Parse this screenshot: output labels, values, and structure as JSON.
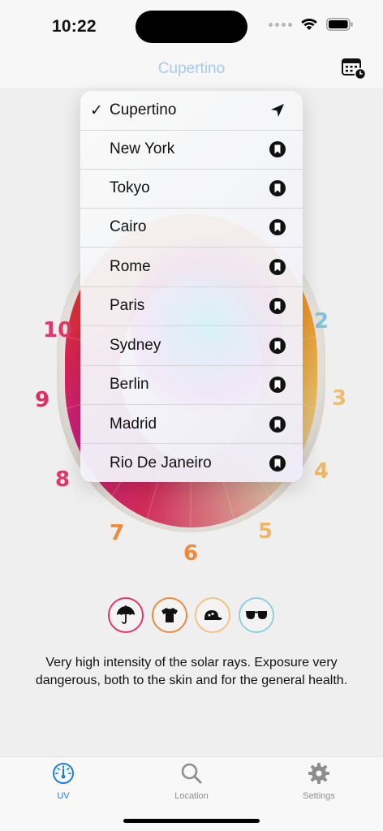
{
  "status_bar": {
    "time": "10:22"
  },
  "nav": {
    "title": "Cupertino",
    "calendar_icon": "calendar-clock-icon"
  },
  "uv_dial": {
    "hours": [
      "10",
      "9",
      "8",
      "7",
      "6",
      "5",
      "4",
      "3",
      "2"
    ],
    "colors": {
      "10": "#e0366a",
      "9": "#de2f63",
      "8": "#e0366a",
      "7": "#ee8a3a",
      "6": "#ef8a3a",
      "5": "#efb56a",
      "4": "#efb56a",
      "3": "#ecbc72",
      "2": "#7cc6d8"
    }
  },
  "location_menu": {
    "items": [
      {
        "label": "Cupertino",
        "selected": true,
        "icon": "location-arrow-icon"
      },
      {
        "label": "New York",
        "selected": false,
        "icon": "bookmark-icon"
      },
      {
        "label": "Tokyo",
        "selected": false,
        "icon": "bookmark-icon"
      },
      {
        "label": "Cairo",
        "selected": false,
        "icon": "bookmark-icon"
      },
      {
        "label": "Rome",
        "selected": false,
        "icon": "bookmark-icon"
      },
      {
        "label": "Paris",
        "selected": false,
        "icon": "bookmark-icon"
      },
      {
        "label": "Sydney",
        "selected": false,
        "icon": "bookmark-icon"
      },
      {
        "label": "Berlin",
        "selected": false,
        "icon": "bookmark-icon"
      },
      {
        "label": "Madrid",
        "selected": false,
        "icon": "bookmark-icon"
      },
      {
        "label": "Rio De Janeiro",
        "selected": false,
        "icon": "bookmark-icon"
      }
    ],
    "check_mark": "✓"
  },
  "protection": [
    {
      "icon": "umbrella-icon",
      "color": "#e0366a"
    },
    {
      "icon": "tshirt-icon",
      "color": "#ee8a3a"
    },
    {
      "icon": "cap-icon",
      "color": "#efc383"
    },
    {
      "icon": "sunglasses-icon",
      "color": "#8fd0e0"
    }
  ],
  "description": "Very high intensity of the solar rays. Exposure very dangerous, both to the skin and for the general health.",
  "tabs": [
    {
      "label": "UV",
      "icon": "gauge-icon",
      "active": true
    },
    {
      "label": "Location",
      "icon": "magnifier-icon",
      "active": false
    },
    {
      "label": "Settings",
      "icon": "gear-icon",
      "active": false
    }
  ],
  "colors": {
    "accent": "#1a7fe0",
    "tab_inactive": "#8e8e8e",
    "nav_title": "#a9c9ee"
  }
}
